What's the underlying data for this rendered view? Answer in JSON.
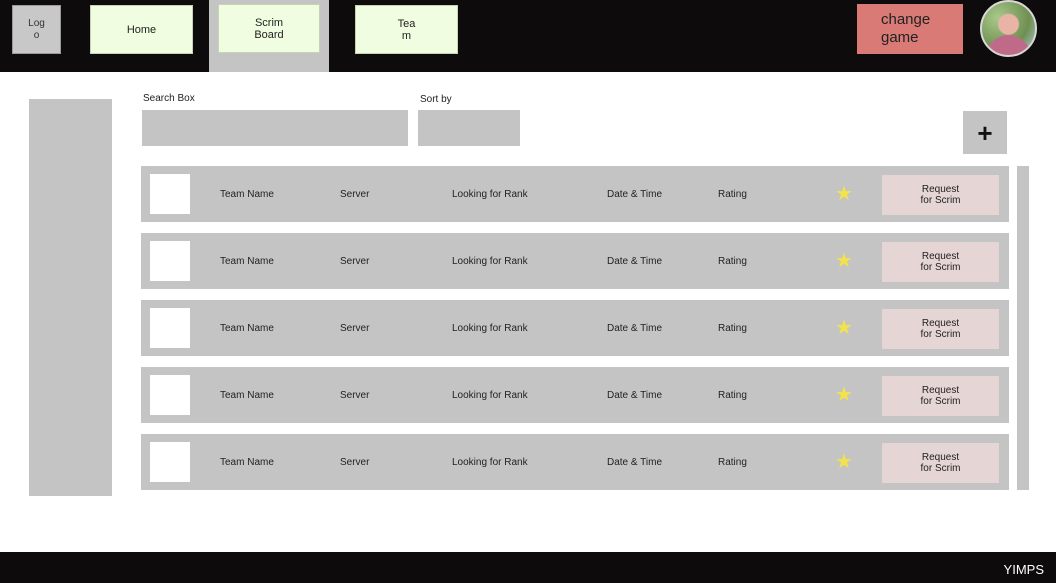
{
  "header": {
    "logo_label": "Logo",
    "nav": [
      "Home",
      "Scrim Board",
      "Team"
    ],
    "change_game_label": "change game"
  },
  "toolbar": {
    "search_label": "Search Box",
    "search_value": "",
    "sort_label": "Sort by",
    "add_icon": "plus-icon",
    "add_glyph": "+"
  },
  "rows": [
    {
      "team": "Team Name",
      "server": "Server",
      "rank": "Looking for Rank",
      "datetime": "Date & Time",
      "rating": "Rating",
      "action": "Request for Scrim"
    },
    {
      "team": "Team Name",
      "server": "Server",
      "rank": "Looking for Rank",
      "datetime": "Date & Time",
      "rating": "Rating",
      "action": "Request for Scrim"
    },
    {
      "team": "Team Name",
      "server": "Server",
      "rank": "Looking for Rank",
      "datetime": "Date & Time",
      "rating": "Rating",
      "action": "Request for Scrim"
    },
    {
      "team": "Team Name",
      "server": "Server",
      "rank": "Looking for Rank",
      "datetime": "Date & Time",
      "rating": "Rating",
      "action": "Request for Scrim"
    },
    {
      "team": "Team Name",
      "server": "Server",
      "rank": "Looking for Rank",
      "datetime": "Date & Time",
      "rating": "Rating",
      "action": "Request for Scrim"
    }
  ],
  "footer": {
    "brand": "YIMPS"
  },
  "colors": {
    "topbar": "#0d0b0b",
    "nav_button": "#f1fde0",
    "change_game": "#d97a76",
    "panel_gray": "#c4c4c4",
    "request_button": "#e6d5d5",
    "star": "#f3e34b"
  }
}
